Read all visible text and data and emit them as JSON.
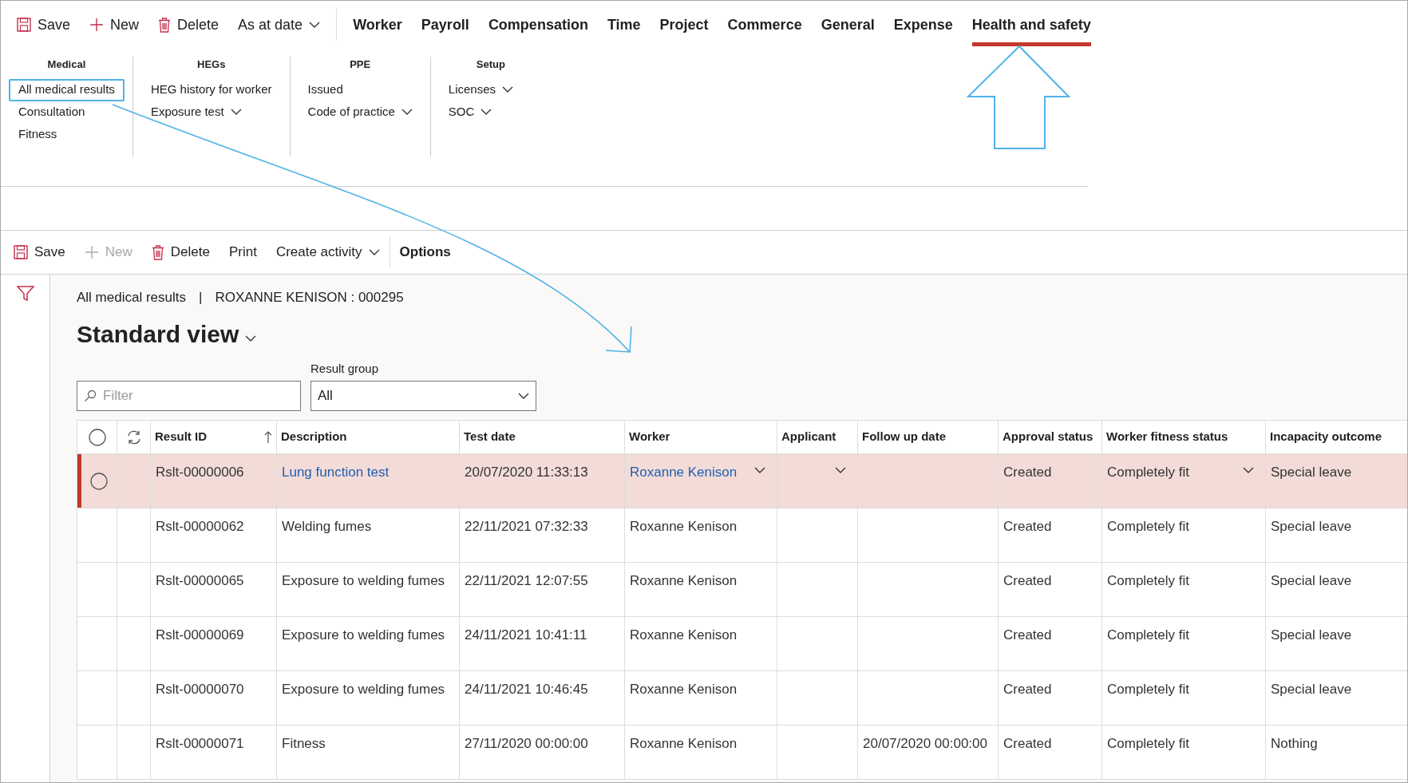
{
  "action_bar": [
    {
      "kind": "save",
      "label": "Save"
    },
    {
      "kind": "new",
      "label": "New"
    },
    {
      "kind": "delete",
      "label": "Delete"
    },
    {
      "kind": "dropdown",
      "label": "As at date"
    }
  ],
  "module_tabs": [
    {
      "label": "Worker",
      "selected": false
    },
    {
      "label": "Payroll",
      "selected": false
    },
    {
      "label": "Compensation",
      "selected": false
    },
    {
      "label": "Time",
      "selected": false
    },
    {
      "label": "Project",
      "selected": false
    },
    {
      "label": "Commerce",
      "selected": false
    },
    {
      "label": "General",
      "selected": false
    },
    {
      "label": "Expense",
      "selected": false
    },
    {
      "label": "Health and safety",
      "selected": true
    }
  ],
  "ribbon_groups": [
    {
      "title": "Medical",
      "items": [
        {
          "label": "All medical results",
          "dropdown": false,
          "highlighted": true
        },
        {
          "label": "Consultation",
          "dropdown": false,
          "highlighted": false
        },
        {
          "label": "Fitness",
          "dropdown": false,
          "highlighted": false
        }
      ]
    },
    {
      "title": "HEGs",
      "items": [
        {
          "label": "HEG history for worker",
          "dropdown": false,
          "highlighted": false
        },
        {
          "label": "Exposure test",
          "dropdown": true,
          "highlighted": false
        }
      ]
    },
    {
      "title": "PPE",
      "items": [
        {
          "label": "Issued",
          "dropdown": false,
          "highlighted": false
        },
        {
          "label": "Code of practice",
          "dropdown": true,
          "highlighted": false
        }
      ]
    },
    {
      "title": "Setup",
      "items": [
        {
          "label": "Licenses",
          "dropdown": true,
          "highlighted": false
        },
        {
          "label": "SOC",
          "dropdown": true,
          "highlighted": false
        }
      ]
    }
  ],
  "page_toolbar": [
    {
      "kind": "save",
      "label": "Save",
      "disabled": false
    },
    {
      "kind": "new",
      "label": "New",
      "disabled": true
    },
    {
      "kind": "delete",
      "label": "Delete",
      "disabled": false
    },
    {
      "kind": "plain",
      "label": "Print",
      "disabled": false
    },
    {
      "kind": "dropdown",
      "label": "Create activity",
      "disabled": false
    },
    {
      "kind": "bold",
      "label": "Options",
      "disabled": false
    }
  ],
  "breadcrumb": {
    "page": "All medical results",
    "separator": "|",
    "record": "ROXANNE KENISON : 000295"
  },
  "view_title": "Standard view",
  "filter": {
    "placeholder": "Filter"
  },
  "result_group": {
    "label": "Result group",
    "value": "All"
  },
  "table": {
    "all_selected": false,
    "columns": [
      {
        "label": "Result ID",
        "sorted": true
      },
      {
        "label": "Description",
        "sorted": false
      },
      {
        "label": "Test date",
        "sorted": false
      },
      {
        "label": "Worker",
        "sorted": false
      },
      {
        "label": "Applicant",
        "sorted": false
      },
      {
        "label": "Follow up date",
        "sorted": false
      },
      {
        "label": "Approval status",
        "sorted": false
      },
      {
        "label": "Worker fitness status",
        "sorted": false
      },
      {
        "label": "Incapacity outcome",
        "sorted": false
      }
    ],
    "rows": [
      {
        "selected": true,
        "cells": [
          "Rslt-00000006",
          "Lung function test",
          "20/07/2020 11:33:13",
          "Roxanne Kenison",
          "",
          "",
          "Created",
          "Completely fit",
          "Special leave"
        ]
      },
      {
        "selected": false,
        "cells": [
          "Rslt-00000062",
          "Welding fumes",
          "22/11/2021 07:32:33",
          "Roxanne Kenison",
          "",
          "",
          "Created",
          "Completely fit",
          "Special leave"
        ]
      },
      {
        "selected": false,
        "cells": [
          "Rslt-00000065",
          "Exposure to welding fumes",
          "22/11/2021 12:07:55",
          "Roxanne Kenison",
          "",
          "",
          "Created",
          "Completely fit",
          "Special leave"
        ]
      },
      {
        "selected": false,
        "cells": [
          "Rslt-00000069",
          "Exposure to welding fumes",
          "24/11/2021 10:41:11",
          "Roxanne Kenison",
          "",
          "",
          "Created",
          "Completely fit",
          "Special leave"
        ]
      },
      {
        "selected": false,
        "cells": [
          "Rslt-00000070",
          "Exposure to welding fumes",
          "24/11/2021 10:46:45",
          "Roxanne Kenison",
          "",
          "",
          "Created",
          "Completely fit",
          "Special leave"
        ]
      },
      {
        "selected": false,
        "cells": [
          "Rslt-00000071",
          "Fitness",
          "27/11/2020 00:00:00",
          "Roxanne Kenison",
          "",
          "20/07/2020 00:00:00",
          "Created",
          "Completely fit",
          "Nothing"
        ]
      }
    ]
  }
}
